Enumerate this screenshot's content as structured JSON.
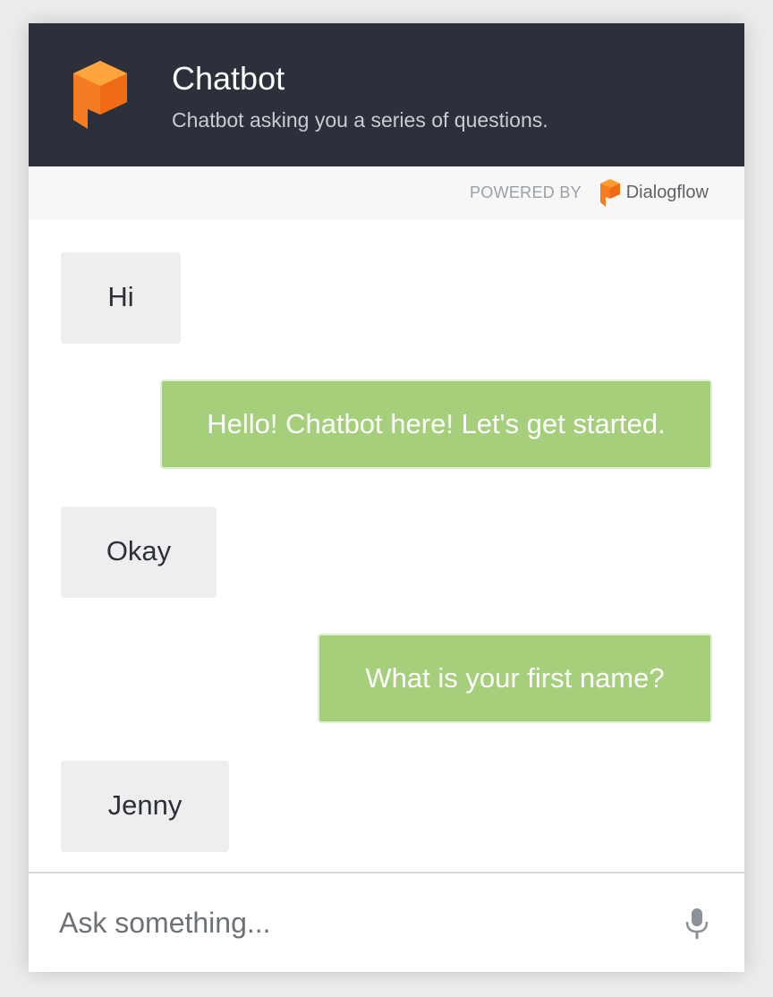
{
  "header": {
    "title": "Chatbot",
    "subtitle": "Chatbot asking you a series of questions.",
    "logo_icon": "dialogflow-cube-icon",
    "accent_color": "#f57c20",
    "background_color": "#2b303b"
  },
  "powered_by": {
    "label": "POWERED BY",
    "brand": "Dialogflow",
    "brand_icon": "dialogflow-cube-icon"
  },
  "messages": [
    {
      "role": "user",
      "text": "Hi"
    },
    {
      "role": "bot",
      "text": "Hello! Chatbot here! Let's get started."
    },
    {
      "role": "user",
      "text": "Okay"
    },
    {
      "role": "bot",
      "text": "What is your first name?"
    },
    {
      "role": "user",
      "text": "Jenny"
    }
  ],
  "input": {
    "placeholder": "Ask something...",
    "value": "",
    "mic_icon": "microphone-icon"
  },
  "colors": {
    "user_bubble": "#eeeeee",
    "bot_bubble": "#a5cf7b"
  }
}
